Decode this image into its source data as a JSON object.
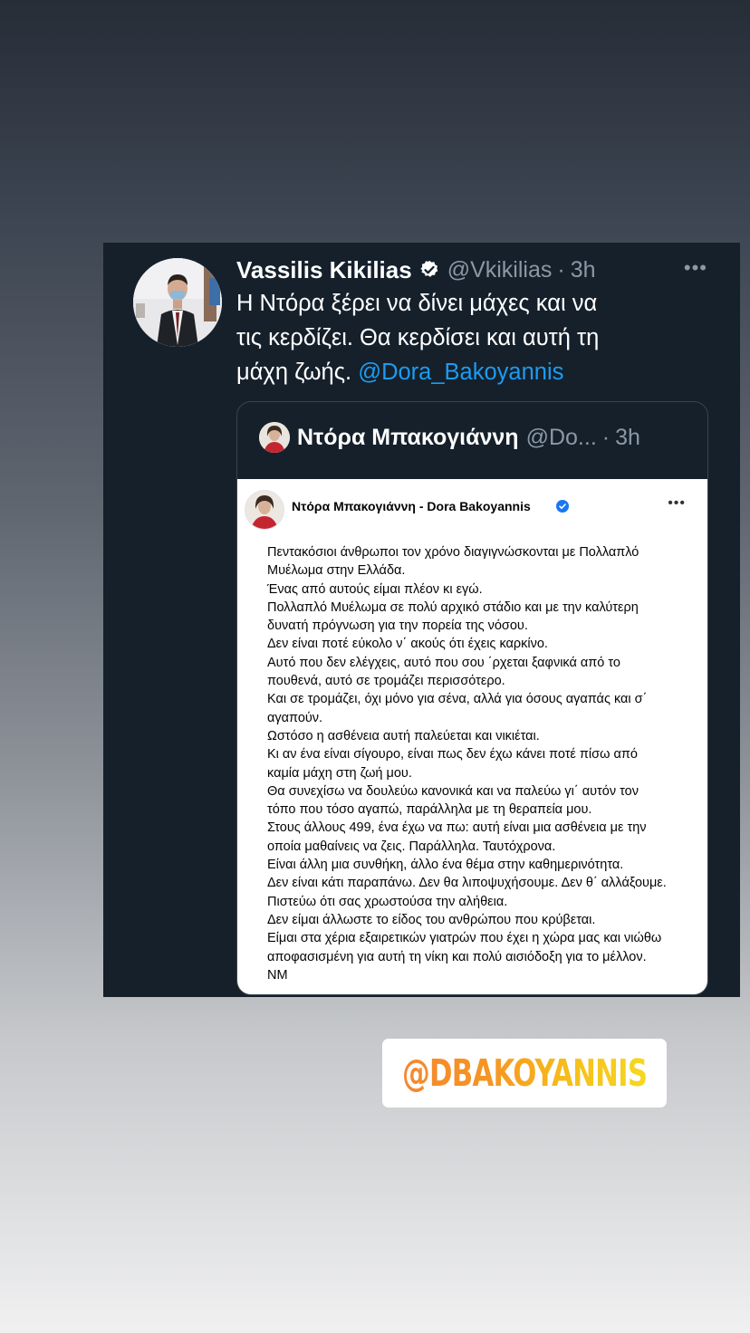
{
  "tweet": {
    "author_name": "Vassilis Kikilias",
    "handle": "@Vkikilias",
    "dot": "·",
    "time": "3h",
    "more_icon": "more-horizontal-icon",
    "text_line1": "Η Ντόρα ξέρει να δίνει μάχες και να",
    "text_line2": "τις κερδίζει. Θα κερδίσει και αυτή τη",
    "text_line3_prefix": "μάχη ζωής. ",
    "mention": "@Dora_Bakoyannis"
  },
  "quote_tweet": {
    "author_name": "Ντόρα Μπακογιάννη",
    "handle": "@Do...",
    "dot": "·",
    "time": "3h"
  },
  "facebook_post": {
    "author_name": "Ντόρα Μπακογιάννη - Dora Bakoyannis",
    "more_icon": "more-horizontal-icon",
    "lines": [
      "Πεντακόσιοι άνθρωποι τον χρόνο διαγιγνώσκονται με Πολλαπλό",
      "Μυέλωμα στην Ελλάδα.",
      "Ένας από αυτούς είμαι πλέον κι εγώ.",
      "Πολλαπλό Μυέλωμα σε πολύ αρχικό στάδιο και με την καλύτερη",
      "δυνατή πρόγνωση για την πορεία της νόσου.",
      "Δεν είναι ποτέ εύκολο ν΄ ακούς ότι έχεις καρκίνο.",
      "Αυτό που δεν ελέγχεις, αυτό που σου ΄ρχεται ξαφνικά από το",
      "πουθενά, αυτό σε τρομάζει περισσότερο.",
      "Και σε τρομάζει, όχι μόνο για σένα, αλλά για όσους αγαπάς και σ΄",
      "αγαπούν.",
      "Ωστόσο η ασθένεια αυτή παλεύεται και νικιέται.",
      "Κι αν ένα είναι σίγουρο, είναι πως δεν έχω κάνει ποτέ πίσω από",
      "καμία μάχη στη ζωή μου.",
      "Θα συνεχίσω να δουλεύω κανονικά και να παλεύω γι΄ αυτόν τον",
      "τόπο που τόσο αγαπώ, παράλληλα με τη θεραπεία μου.",
      "Στους άλλους 499, ένα έχω να πω: αυτή είναι μια ασθένεια με την",
      "οποία μαθαίνεις να ζεις. Παράλληλα. Ταυτόχρονα.",
      "Είναι άλλη μια συνθήκη, άλλο ένα θέμα στην καθημερινότητα.",
      "Δεν είναι κάτι παραπάνω. Δεν θα λιποψυχήσουμε. Δεν θ΄ αλλάξουμε.",
      "Πιστεύω ότι σας χρωστούσα την αλήθεια.",
      "Δεν είμαι άλλωστε το είδος του ανθρώπου που κρύβεται.",
      "Είμαι στα χέρια εξαιρετικών γιατρών που έχει η χώρα μας και νιώθω",
      "αποφασισμένη για αυτή τη νίκη και πολύ αισιόδοξη για το μέλλον.",
      "ΝΜ"
    ]
  },
  "sticker": {
    "text": "@DBAKOYANNIS"
  },
  "colors": {
    "card_background": "#15202b",
    "link_blue": "#1d9bf0",
    "secondary_text": "#8b98a5",
    "sticker_gradient_start": "#f6872f",
    "sticker_gradient_end": "#f6d821"
  }
}
